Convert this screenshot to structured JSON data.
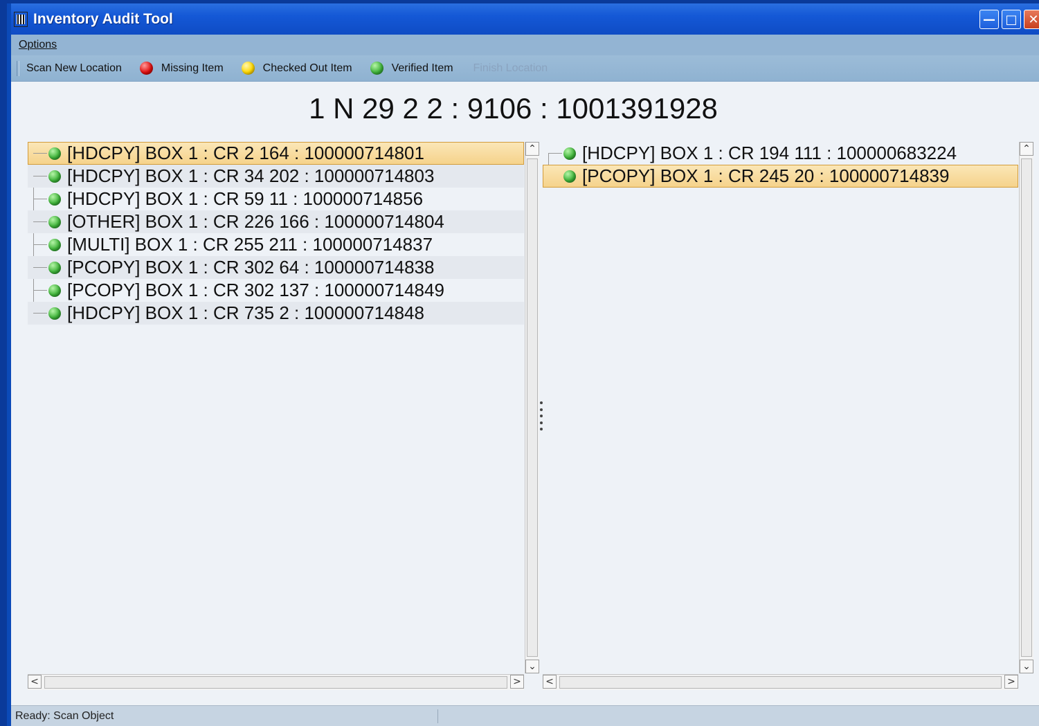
{
  "window": {
    "title": "Inventory Audit Tool"
  },
  "menu": {
    "options": "Options"
  },
  "toolbar": {
    "scan_new_location": "Scan New Location",
    "missing_item": "Missing Item",
    "checked_out_item": "Checked Out Item",
    "verified_item": "Verified Item",
    "finish_location": "Finish Location"
  },
  "location_heading": "1 N 29 2 2 : 9106 : 1001391928",
  "left_list": [
    "[HDCPY] BOX 1 : CR 2 164 : 100000714801",
    "[HDCPY] BOX 1 : CR 34 202 : 100000714803",
    "[HDCPY] BOX 1 : CR 59 11 : 100000714856",
    "[OTHER] BOX 1 : CR 226 166 : 100000714804",
    "[MULTI] BOX 1 : CR 255 211 : 100000714837",
    "[PCOPY] BOX 1 : CR 302 64 : 100000714838",
    "[PCOPY] BOX 1 : CR 302 137 : 100000714849",
    "[HDCPY] BOX 1 : CR 735 2 : 100000714848"
  ],
  "right_list": [
    "[HDCPY] BOX 1 : CR 194 111 : 100000683224",
    "[PCOPY] BOX 1 : CR 245 20 : 100000714839"
  ],
  "status": {
    "text": "Ready: Scan Object"
  },
  "colors": {
    "missing": "#e01010",
    "checked_out": "#ffd800",
    "verified": "#3fb33a",
    "selection": "#f5d28a"
  }
}
